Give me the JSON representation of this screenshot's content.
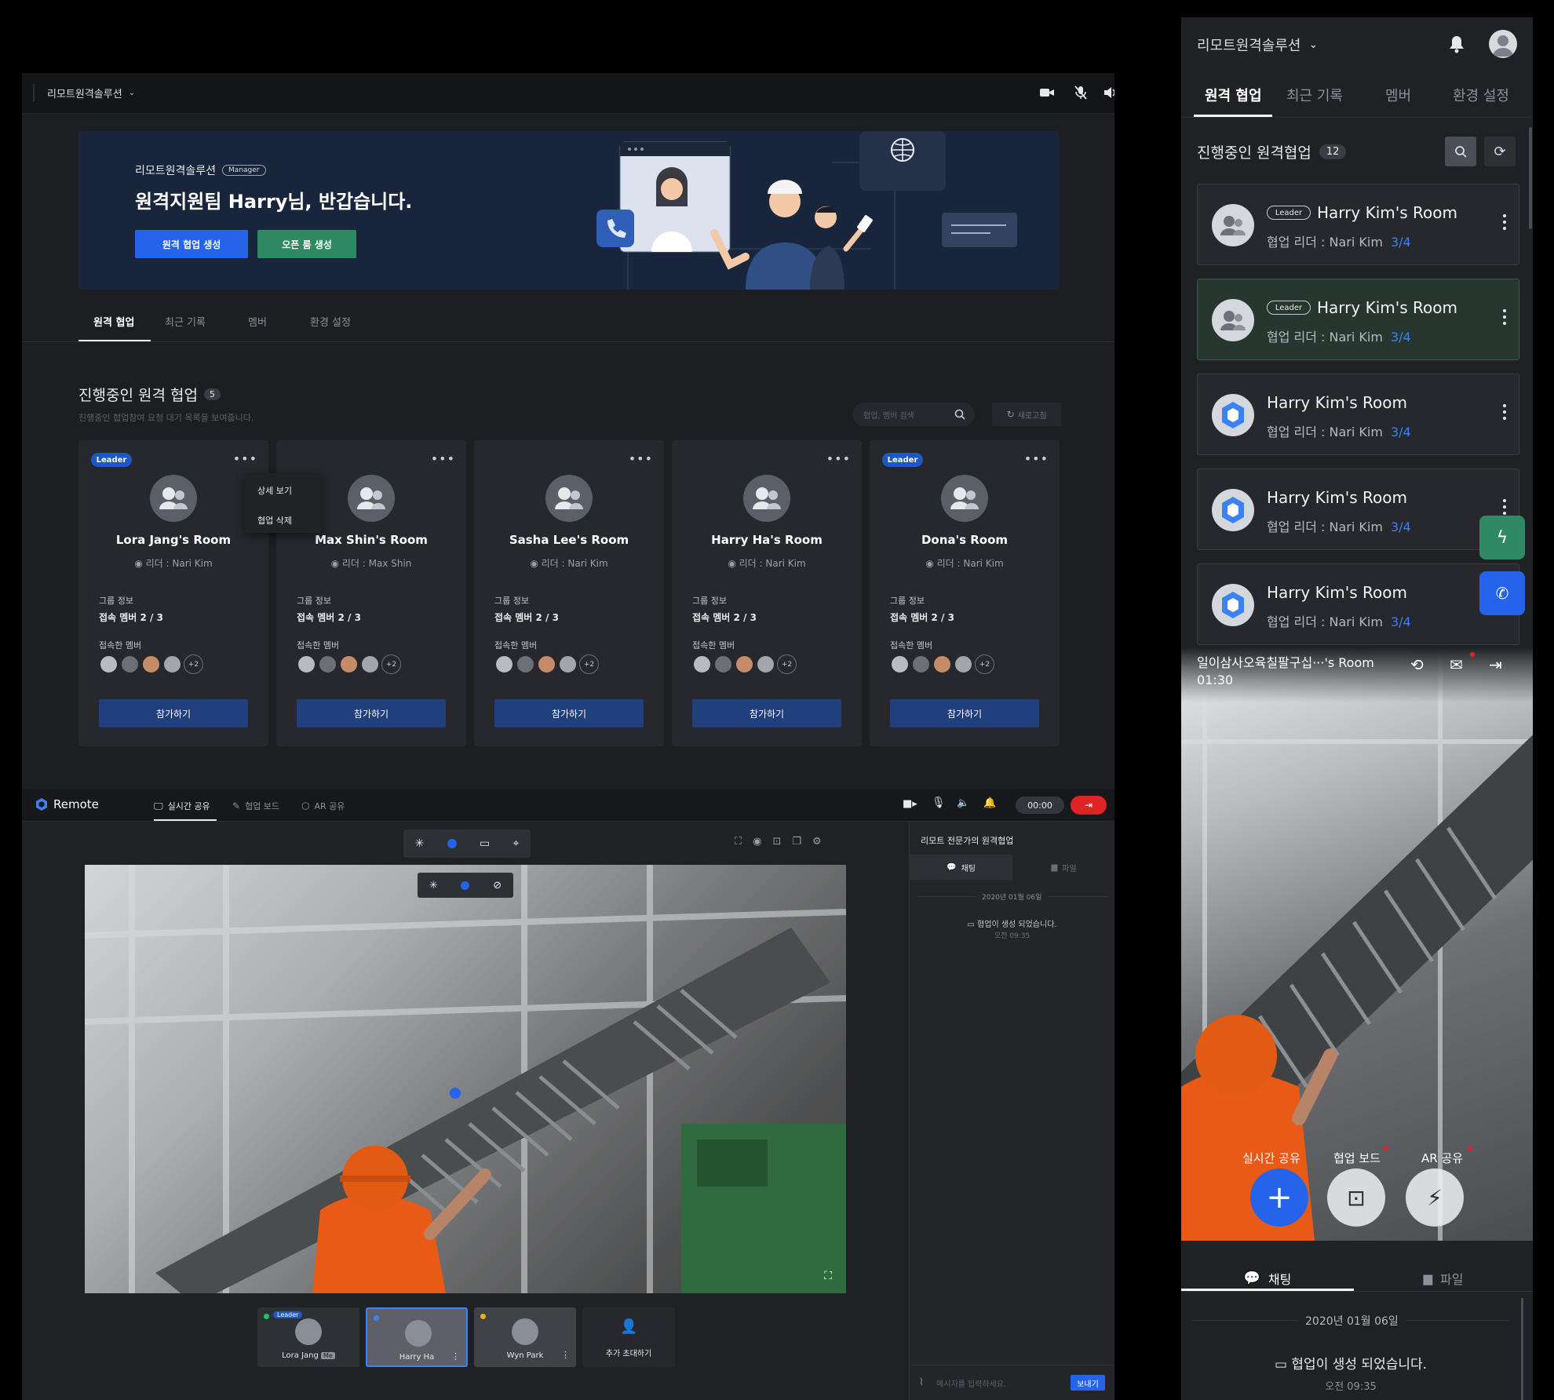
{
  "desktop": {
    "app_title": "리모트원격솔루션",
    "banner": {
      "app_name": "리모트원격솔루션",
      "role_badge": "Manager",
      "greeting": "원격지원팀 Harry님, 반갑습니다.",
      "create_button": "원격 협업 생성",
      "open_room_button": "오픈 룸 생성"
    },
    "tabs": [
      "원격 협업",
      "최근 기록",
      "멤버",
      "환경 설정"
    ],
    "section": {
      "title": "진행중인 원격 협업",
      "count": "5",
      "description": "진행중인 협업참여 요청 대기 목록을 보여줍니다.",
      "search_placeholder": "협업, 멤버 검색",
      "refresh_label": "새로고침"
    },
    "context_menu": [
      "상세 보기",
      "협업 삭제"
    ],
    "cards": [
      {
        "leader_badge": "Leader",
        "name": "Lora Jang's Room",
        "leader": "리더 : Nari Kim",
        "group_label": "그룹 정보",
        "members": "접속 멤버  2 / 3",
        "joined_label": "접속한 멤버",
        "extra": "+2",
        "join": "참가하기"
      },
      {
        "leader_badge": "",
        "name": "Max Shin's Room",
        "leader": "리더 : Max Shin",
        "group_label": "그룹 정보",
        "members": "접속 멤버  2 / 3",
        "joined_label": "접속한 멤버",
        "extra": "+2",
        "join": "참가하기"
      },
      {
        "leader_badge": "",
        "name": "Sasha Lee's Room",
        "leader": "리더 : Nari Kim",
        "group_label": "그룹 정보",
        "members": "접속 멤버  2 / 3",
        "joined_label": "접속한 멤버",
        "extra": "+2",
        "join": "참가하기"
      },
      {
        "leader_badge": "",
        "name": "Harry Ha's Room",
        "leader": "리더 : Nari Kim",
        "group_label": "그룹 정보",
        "members": "접속 멤버  2 / 3",
        "joined_label": "접속한 멤버",
        "extra": "+2",
        "join": "참가하기"
      },
      {
        "leader_badge": "Leader",
        "name": "Dona's Room",
        "leader": "리더 : Nari Kim",
        "group_label": "그룹 정보",
        "members": "접속 멤버  2 / 3",
        "joined_label": "접속한 멤버",
        "extra": "+2",
        "join": "참가하기"
      }
    ]
  },
  "remote": {
    "logo": "Remote",
    "tabs": [
      "실시간 공유",
      "협업 보드",
      "AR 공유"
    ],
    "timer": "00:00",
    "chat": {
      "title": "리모트 전문가의 원격협업",
      "tab_chat": "채팅",
      "tab_file": "파일",
      "date": "2020년 01월 06일",
      "system_message": "협업이 생성 되었습니다.",
      "time": "오전 09:35",
      "input_placeholder": "메시지를 입력하세요.",
      "send": "보내기"
    },
    "participants": [
      {
        "badge": "Leader",
        "name": "Lora Jang",
        "me": "Me"
      },
      {
        "name": "Harry Ha"
      },
      {
        "name": "Wyn Park"
      }
    ],
    "invite": "추가 초대하기"
  },
  "mobile": {
    "app_title": "리모트원격솔루션",
    "tabs": [
      "원격 협업",
      "최근 기록",
      "멤버",
      "환경 설정"
    ],
    "section_title": "진행중인 원격협업",
    "count": "12",
    "rooms": [
      {
        "leader_badge": "Leader",
        "name": "Harry Kim's Room",
        "leader": "협업 리더 : Nari Kim",
        "members": "3/4"
      },
      {
        "leader_badge": "Leader",
        "name": "Harry Kim's Room",
        "leader": "협업 리더 : Nari Kim",
        "members": "3/4"
      },
      {
        "leader_badge": "",
        "name": "Harry Kim's Room",
        "leader": "협업 리더 : Nari Kim",
        "members": "3/4"
      },
      {
        "leader_badge": "",
        "name": "Harry Kim's Room",
        "leader": "협업 리더 : Nari Kim",
        "members": "3/4"
      },
      {
        "leader_badge": "",
        "name": "Harry Kim's Room",
        "leader": "협업 리더 : Nari Kim",
        "members": "3/4"
      }
    ],
    "session": {
      "room_title": "일이삼사오육칠팔구십···'s Room",
      "elapsed": "01:30",
      "modes": [
        "실시간 공유",
        "협업 보드",
        "AR 공유"
      ]
    },
    "chat": {
      "tab_chat": "채팅",
      "tab_file": "파일",
      "date": "2020년 01월 06일",
      "system_message": "협업이 생성 되었습니다.",
      "time": "오전 09:35"
    }
  },
  "colors": {
    "accent_blue": "#2563eb",
    "accent_green": "#2f8a63",
    "end_call_red": "#e02424",
    "selected_card_green": "#27362f"
  }
}
